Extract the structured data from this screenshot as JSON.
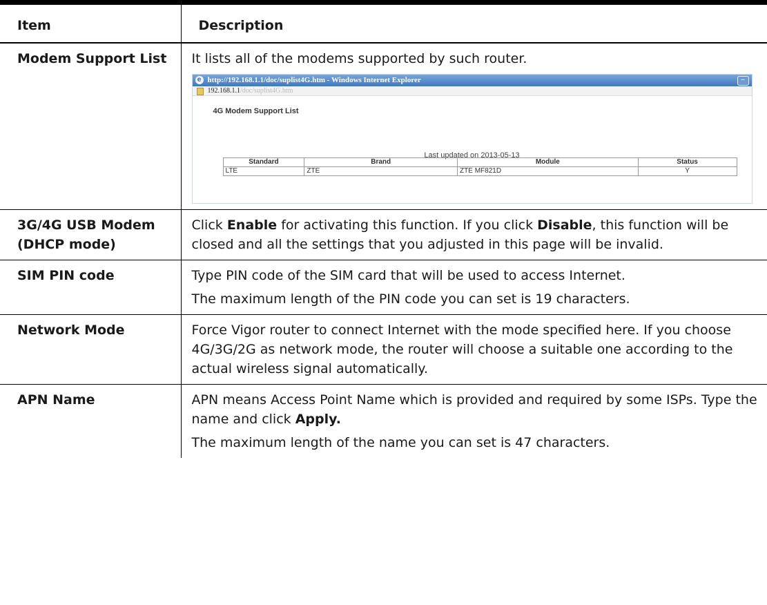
{
  "table": {
    "headers": {
      "item": "Item",
      "description": "Description"
    },
    "rows": [
      {
        "item": "Modem Support List",
        "desc": "It lists all of the modems supported by such router."
      },
      {
        "item": "3G/4G USB Modem (DHCP mode)",
        "desc_a": "Click ",
        "desc_b": "Enable",
        "desc_c": " for activating this function. If you click ",
        "desc_d": "Disable",
        "desc_e": ", this function will be closed and all the settings that you adjusted in this page will be invalid."
      },
      {
        "item": "SIM PIN code",
        "desc_p1": "Type PIN code of the SIM card that will be used to access Internet.",
        "desc_p2": "The maximum length of the PIN code you can set is 19 characters."
      },
      {
        "item": "Network Mode",
        "desc": "Force Vigor router to connect Internet with the mode specified here. If you choose 4G/3G/2G as network mode, the router will choose a suitable one according to the actual wireless signal automatically."
      },
      {
        "item": "APN Name",
        "desc_p1_a": "APN means Access Point Name which is provided and required by some ISPs. Type the name and click ",
        "desc_p1_b": "Apply.",
        "desc_p2": "The maximum length of the name you can set is 47 characters."
      }
    ]
  },
  "screenshot": {
    "window_title": "http://192.168.1.1/doc/suplist4G.htm - Windows Internet Explorer",
    "address": "192.168.1.1",
    "address_faded": "/doc/suplist4G.htm",
    "page_title": "4G Modem Support List",
    "updated": "Last updated on 2013-05-13",
    "columns": [
      "Standard",
      "Brand",
      "Module",
      "Status"
    ],
    "row": {
      "standard": "LTE",
      "brand": "ZTE",
      "module": "ZTE MF821D",
      "status": "Y"
    },
    "icons": {
      "browser": "ie-icon",
      "minimize": "minimize-icon",
      "page": "page-icon"
    }
  }
}
